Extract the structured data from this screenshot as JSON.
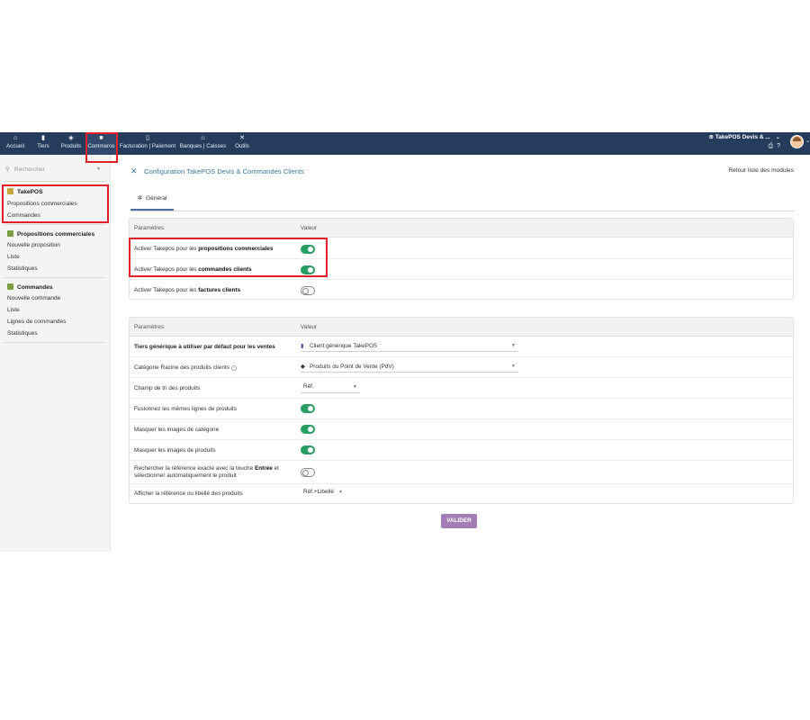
{
  "nav": {
    "items": [
      {
        "label": "Accueil",
        "icon": "home-icon"
      },
      {
        "label": "Tiers",
        "icon": "building-icon"
      },
      {
        "label": "Produits",
        "icon": "cube-icon"
      },
      {
        "label": "Commerce",
        "icon": "suitcase-icon"
      },
      {
        "label": "Facturation | Paiement",
        "icon": "invoice-icon"
      },
      {
        "label": "Banques | Caisses",
        "icon": "bank-icon"
      },
      {
        "label": "Outils",
        "icon": "tools-icon"
      }
    ],
    "company": "TakePOS Devis & ..."
  },
  "sidebar": {
    "search_placeholder": "Rechercher",
    "sections": [
      {
        "title": "TakePOS",
        "links": [
          "Propositions commerciales",
          "Commandes"
        ]
      },
      {
        "title": "Propositions commerciales",
        "links": [
          "Nouvelle proposition",
          "Liste",
          "Statistiques"
        ]
      },
      {
        "title": "Commandes",
        "links": [
          "Nouvelle commande",
          "Liste",
          "Lignes de commandes",
          "Statistiques"
        ]
      }
    ]
  },
  "main": {
    "title": "Configuration TakePOS Devis & Commandes Clients",
    "back_link": "Retour liste des modules",
    "tab": "Général",
    "col_params": "Paramètres",
    "col_value": "Valeur",
    "panel1": [
      {
        "prefix": "Activer Takepos pour les ",
        "strong": "propositions commerciales",
        "enabled": true
      },
      {
        "prefix": "Activer Takepos pour les ",
        "strong": "commandes clients",
        "enabled": true
      },
      {
        "prefix": "Activer Takepos pour les ",
        "strong": "factures clients",
        "enabled": false
      }
    ],
    "panel2": {
      "default_thirdparty_label": "Tiers générique à utiliser par défaut pour les ventes",
      "default_thirdparty_value": "Client générique TakePOS",
      "root_category_label": "Catégorie Racine des produits clients",
      "root_category_value": "Produits du Point de Vente (PdV)",
      "sort_field_label": "Champ de tri des produits",
      "sort_field_value": "Réf.",
      "merge_lines_label": "Fusionnez les mêmes lignes de produits",
      "merge_lines": true,
      "hide_cat_images_label": "Masquer les images de catégorie",
      "hide_cat_images": true,
      "hide_prod_images_label": "Masquer les images de produits",
      "hide_prod_images": true,
      "exact_ref_label_1": "Rechercher la référence exacte avec la touche ",
      "exact_ref_key": "Entrée",
      "exact_ref_label_2": " et",
      "exact_ref_label_3": "sélectionner automatiquement le produit",
      "exact_ref": false,
      "display_ref_label": "Afficher la référence ou libellé des produits",
      "display_ref_value": "Réf.+Libellé"
    },
    "submit": "VALIDER"
  },
  "colors": {
    "topbar": "#263c5c",
    "toggle_on": "#2a9d63",
    "submit": "#a37eb5",
    "title": "#3a7a9f",
    "highlight": "#e0202a"
  }
}
